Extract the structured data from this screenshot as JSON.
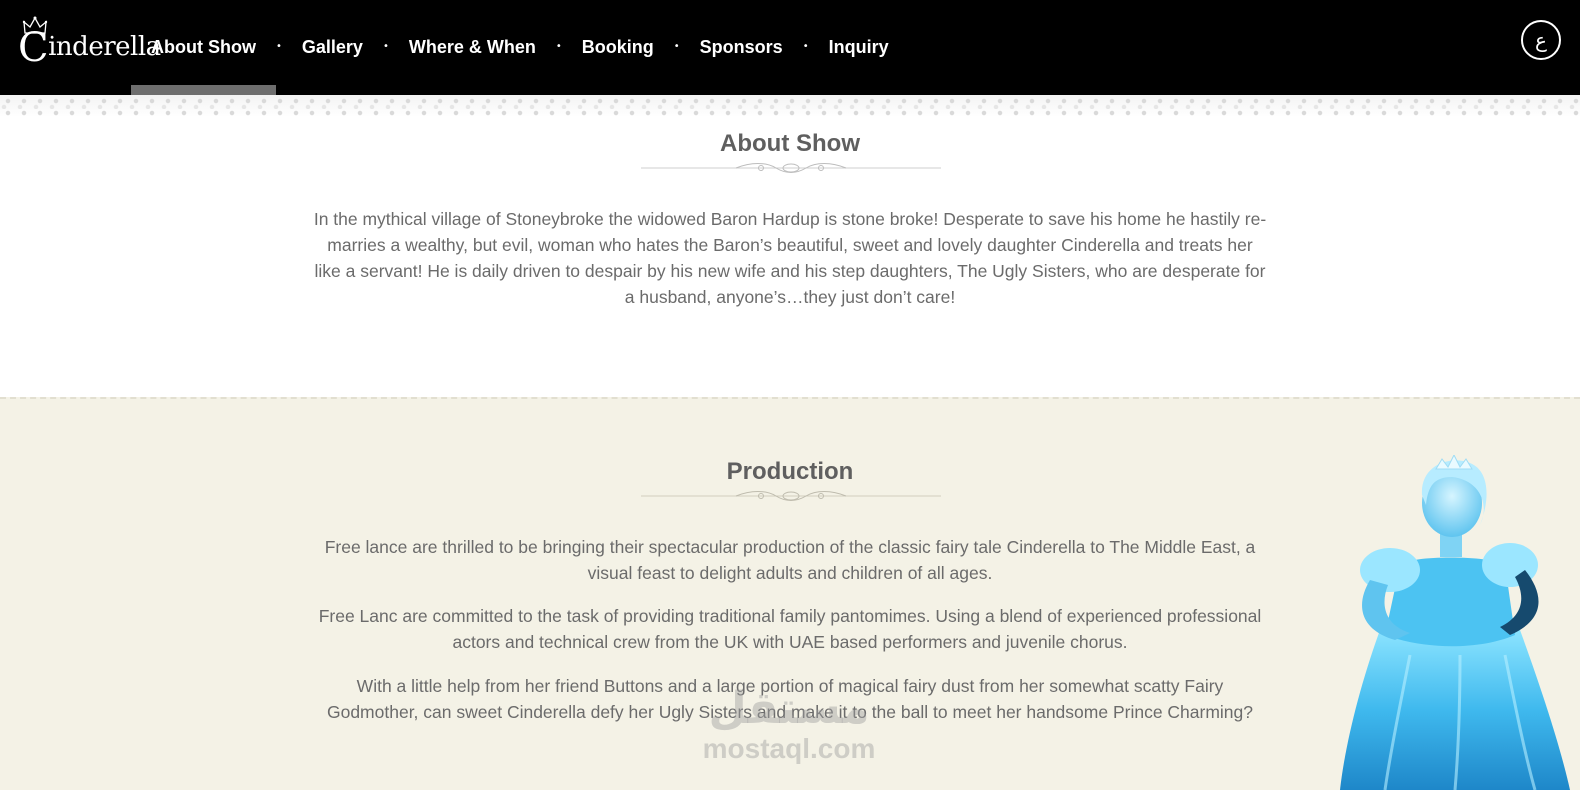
{
  "header": {
    "logo_text": "Cinderella",
    "nav": [
      {
        "label": "About Show",
        "active": true
      },
      {
        "label": "Gallery"
      },
      {
        "label": "Where & When"
      },
      {
        "label": "Booking"
      },
      {
        "label": "Sponsors"
      },
      {
        "label": "Inquiry"
      }
    ],
    "nav_separator": "•",
    "language_toggle": "ع"
  },
  "about": {
    "title": "About Show",
    "body": "In the mythical village of Stoneybroke the widowed Baron Hardup is stone broke! Desperate to save his home he hastily re-marries a wealthy, but evil, woman who hates the Baron’s beautiful, sweet and lovely daughter Cinderella and treats her like a servant! He is daily driven to despair by his new wife and his step daughters, The Ugly Sisters, who are desperate for a husband, anyone’s…they just don’t care!"
  },
  "production": {
    "title": "Production",
    "paragraphs": [
      "Free lance are thrilled to be bringing their spectacular production of the classic fairy tale Cinderella to The Middle East, a visual feast to delight adults and children of all ages.",
      "Free Lanc are committed to the task of providing traditional family pantomimes. Using a blend of experienced professional actors and technical crew from the UK with UAE based performers and juvenile chorus.",
      "With a little help from her friend Buttons and a large portion of magical fairy dust from her somewhat scatty Fairy Godmother, can sweet Cinderella defy her Ugly Sisters and make it to the ball to meet her handsome Prince Charming?"
    ]
  },
  "watermark": {
    "arabic": "مستقل",
    "latin": "mostaql.com"
  },
  "colors": {
    "header_bg": "#000000",
    "active_indicator": "#6e6e6e",
    "production_bg": "#f4f2e6",
    "text": "#6b6b6b"
  }
}
